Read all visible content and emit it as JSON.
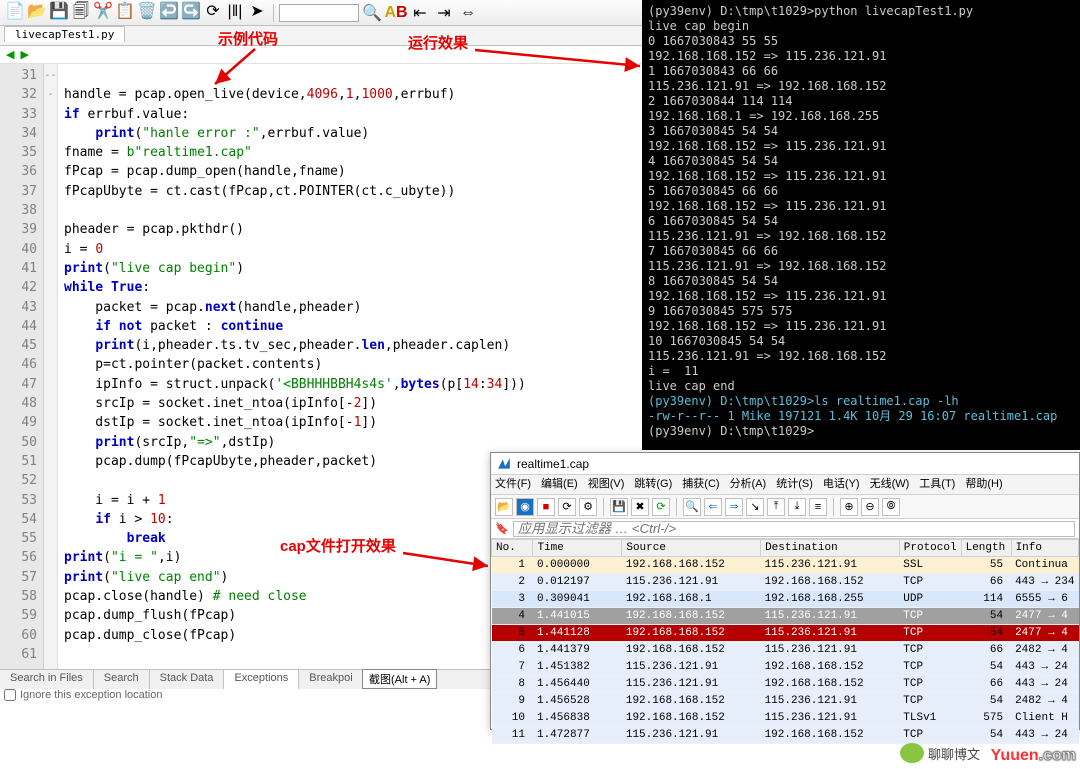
{
  "toolbar_icons": [
    "📄",
    "📂",
    "💾",
    "🗐",
    "✂️",
    "📋",
    "🗑️",
    "↩️",
    "↪️",
    "⟳",
    "|‖|",
    "➤"
  ],
  "annotations": {
    "sample_code": "示例代码",
    "run_effect": "运行效果",
    "cap_open": "cap文件打开效果"
  },
  "editor": {
    "tab": "livecapTest1.py",
    "first_line": 31,
    "tokens": [
      [],
      [
        [
          "fn",
          "handle = pcap.open_live(device,"
        ],
        [
          "num",
          "4096"
        ],
        [
          "fn",
          ","
        ],
        [
          "num",
          "1"
        ],
        [
          "fn",
          ","
        ],
        [
          "num",
          "1000"
        ],
        [
          "fn",
          ",errbuf)"
        ]
      ],
      [
        [
          "kw",
          "if"
        ],
        [
          "fn",
          " errbuf.value:"
        ]
      ],
      [
        [
          "fn",
          "    "
        ],
        [
          "kw",
          "print"
        ],
        [
          "fn",
          "("
        ],
        [
          "str",
          "\"hanle error :\""
        ],
        [
          "fn",
          ",errbuf.value)"
        ]
      ],
      [
        [
          "fn",
          "fname = "
        ],
        [
          "str",
          "b\"realtime1.cap\""
        ]
      ],
      [
        [
          "fn",
          "fPcap = pcap.dump_open(handle,fname)"
        ]
      ],
      [
        [
          "fn",
          "fPcapUbyte = ct.cast(fPcap,ct.POINTER(ct.c_ubyte))"
        ]
      ],
      [],
      [
        [
          "fn",
          "pheader = pcap.pkthdr()"
        ]
      ],
      [
        [
          "fn",
          "i = "
        ],
        [
          "num",
          "0"
        ]
      ],
      [
        [
          "kw",
          "print"
        ],
        [
          "fn",
          "("
        ],
        [
          "str",
          "\"live cap begin\""
        ],
        [
          "fn",
          ")"
        ]
      ],
      [
        [
          "kw",
          "while"
        ],
        [
          "fn",
          " "
        ],
        [
          "kw",
          "True"
        ],
        [
          "fn",
          ":"
        ]
      ],
      [
        [
          "fn",
          "    packet = pcap."
        ],
        [
          "kw",
          "next"
        ],
        [
          "fn",
          "(handle,pheader)"
        ]
      ],
      [
        [
          "fn",
          "    "
        ],
        [
          "kw",
          "if not"
        ],
        [
          "fn",
          " packet : "
        ],
        [
          "kw",
          "continue"
        ]
      ],
      [
        [
          "fn",
          "    "
        ],
        [
          "kw",
          "print"
        ],
        [
          "fn",
          "(i,pheader.ts.tv_sec,pheader."
        ],
        [
          "kw",
          "len"
        ],
        [
          "fn",
          ",pheader.caplen)"
        ]
      ],
      [
        [
          "fn",
          "    p=ct.pointer(packet.contents)"
        ]
      ],
      [
        [
          "fn",
          "    ipInfo = struct.unpack("
        ],
        [
          "str",
          "'<BBHHHBBH4s4s'"
        ],
        [
          "fn",
          ","
        ],
        [
          "kw",
          "bytes"
        ],
        [
          "fn",
          "(p["
        ],
        [
          "num",
          "14"
        ],
        [
          "fn",
          ":"
        ],
        [
          "num",
          "34"
        ],
        [
          "fn",
          "]))"
        ]
      ],
      [
        [
          "fn",
          "    srcIp = socket.inet_ntoa(ipInfo[-"
        ],
        [
          "num",
          "2"
        ],
        [
          "fn",
          "])"
        ]
      ],
      [
        [
          "fn",
          "    dstIp = socket.inet_ntoa(ipInfo[-"
        ],
        [
          "num",
          "1"
        ],
        [
          "fn",
          "])"
        ]
      ],
      [
        [
          "fn",
          "    "
        ],
        [
          "kw",
          "print"
        ],
        [
          "fn",
          "(srcIp,"
        ],
        [
          "str",
          "\"=>\""
        ],
        [
          "fn",
          ",dstIp)"
        ]
      ],
      [
        [
          "fn",
          "    pcap.dump(fPcapUbyte,pheader,packet)"
        ]
      ],
      [],
      [
        [
          "fn",
          "    i = i + "
        ],
        [
          "num",
          "1"
        ]
      ],
      [
        [
          "fn",
          "    "
        ],
        [
          "kw",
          "if"
        ],
        [
          "fn",
          " i > "
        ],
        [
          "num",
          "10"
        ],
        [
          "fn",
          ":"
        ]
      ],
      [
        [
          "fn",
          "        "
        ],
        [
          "kw",
          "break"
        ]
      ],
      [
        [
          "kw",
          "print"
        ],
        [
          "fn",
          "("
        ],
        [
          "str",
          "\"i = \""
        ],
        [
          "fn",
          ",i)"
        ]
      ],
      [
        [
          "kw",
          "print"
        ],
        [
          "fn",
          "("
        ],
        [
          "str",
          "\"live cap end\""
        ],
        [
          "fn",
          ")"
        ]
      ],
      [
        [
          "fn",
          "pcap.close(handle) "
        ],
        [
          "cm",
          "# need close"
        ]
      ],
      [
        [
          "fn",
          "pcap.dump_flush(fPcap)"
        ]
      ],
      [
        [
          "fn",
          "pcap.dump_close(fPcap)"
        ]
      ],
      []
    ],
    "fold_markers": {
      "33": "-",
      "42": "-",
      "54": "-"
    }
  },
  "bottom_tabs": [
    "Search in Files",
    "Search",
    "Stack Data",
    "Exceptions",
    "Breakpoi"
  ],
  "bottom_tab_active": 3,
  "shortcut_label": "截图(Alt + A)",
  "ignore_label": "Ignore this exception location",
  "terminal_lines": [
    "(py39env) D:\\tmp\\t1029>python livecapTest1.py",
    "live cap begin",
    "0 1667030843 55 55",
    "192.168.168.152 => 115.236.121.91",
    "1 1667030843 66 66",
    "115.236.121.91 => 192.168.168.152",
    "2 1667030844 114 114",
    "192.168.168.1 => 192.168.168.255",
    "3 1667030845 54 54",
    "192.168.168.152 => 115.236.121.91",
    "4 1667030845 54 54",
    "192.168.168.152 => 115.236.121.91",
    "5 1667030845 66 66",
    "192.168.168.152 => 115.236.121.91",
    "6 1667030845 54 54",
    "115.236.121.91 => 192.168.168.152",
    "7 1667030845 66 66",
    "115.236.121.91 => 192.168.168.152",
    "8 1667030845 54 54",
    "192.168.168.152 => 115.236.121.91",
    "9 1667030845 575 575",
    "192.168.168.152 => 115.236.121.91",
    "10 1667030845 54 54",
    "115.236.121.91 => 192.168.168.152",
    "i =  11",
    "live cap end",
    "",
    "(py39env) D:\\tmp\\t1029>ls realtime1.cap -lh",
    "-rw-r--r-- 1 Mike 197121 1.4K 10月 29 16:07 realtime1.cap",
    "",
    "(py39env) D:\\tmp\\t1029>"
  ],
  "terminal_color_lines": [
    27,
    28
  ],
  "wireshark": {
    "title": "realtime1.cap",
    "menu": [
      "文件(F)",
      "编辑(E)",
      "视图(V)",
      "跳转(G)",
      "捕获(C)",
      "分析(A)",
      "统计(S)",
      "电话(Y)",
      "无线(W)",
      "工具(T)",
      "帮助(H)"
    ],
    "filter_placeholder": "应用显示过滤器 … <Ctrl-/>",
    "columns": [
      "No.",
      "Time",
      "Source",
      "Destination",
      "Protocol",
      "Length",
      "Info"
    ],
    "col_widths": [
      "42px",
      "90px",
      "140px",
      "140px",
      "60px",
      "50px",
      "auto"
    ],
    "rows": [
      {
        "no": "1",
        "time": "0.000000",
        "src": "192.168.168.152",
        "dst": "115.236.121.91",
        "proto": "SSL",
        "len": "55",
        "info": "Continua",
        "bg": "#fbf0d2"
      },
      {
        "no": "2",
        "time": "0.012197",
        "src": "115.236.121.91",
        "dst": "192.168.168.152",
        "proto": "TCP",
        "len": "66",
        "info": "443 → 234",
        "bg": "#e6eefb"
      },
      {
        "no": "3",
        "time": "0.309041",
        "src": "192.168.168.1",
        "dst": "192.168.168.255",
        "proto": "UDP",
        "len": "114",
        "info": "6555 → 6",
        "bg": "#d8e7fb"
      },
      {
        "no": "4",
        "time": "1.441015",
        "src": "192.168.168.152",
        "dst": "115.236.121.91",
        "proto": "TCP",
        "len": "54",
        "info": "2477 → 4",
        "bg": "#a0a0a0",
        "fg": "#fff"
      },
      {
        "no": "5",
        "time": "1.441128",
        "src": "192.168.168.152",
        "dst": "115.236.121.91",
        "proto": "TCP",
        "len": "54",
        "info": "2477 → 4",
        "bg": "#b40000",
        "fg": "#fff"
      },
      {
        "no": "6",
        "time": "1.441379",
        "src": "192.168.168.152",
        "dst": "115.236.121.91",
        "proto": "TCP",
        "len": "66",
        "info": "2482 → 4",
        "bg": "#e6eefb"
      },
      {
        "no": "7",
        "time": "1.451382",
        "src": "115.236.121.91",
        "dst": "192.168.168.152",
        "proto": "TCP",
        "len": "54",
        "info": "443 → 24",
        "bg": "#e6eefb"
      },
      {
        "no": "8",
        "time": "1.456440",
        "src": "115.236.121.91",
        "dst": "192.168.168.152",
        "proto": "TCP",
        "len": "66",
        "info": "443 → 24",
        "bg": "#e6eefb"
      },
      {
        "no": "9",
        "time": "1.456528",
        "src": "192.168.168.152",
        "dst": "115.236.121.91",
        "proto": "TCP",
        "len": "54",
        "info": "2482 → 4",
        "bg": "#e6eefb"
      },
      {
        "no": "10",
        "time": "1.456838",
        "src": "192.168.168.152",
        "dst": "115.236.121.91",
        "proto": "TLSv1",
        "len": "575",
        "info": "Client H",
        "bg": "#e6eefb"
      },
      {
        "no": "11",
        "time": "1.472877",
        "src": "115.236.121.91",
        "dst": "192.168.168.152",
        "proto": "TCP",
        "len": "54",
        "info": "443 → 24",
        "bg": "#e6eefb"
      }
    ]
  },
  "watermark_a": "Yuuen",
  "watermark_b": ".com",
  "wechat_label": "聊聊博文"
}
